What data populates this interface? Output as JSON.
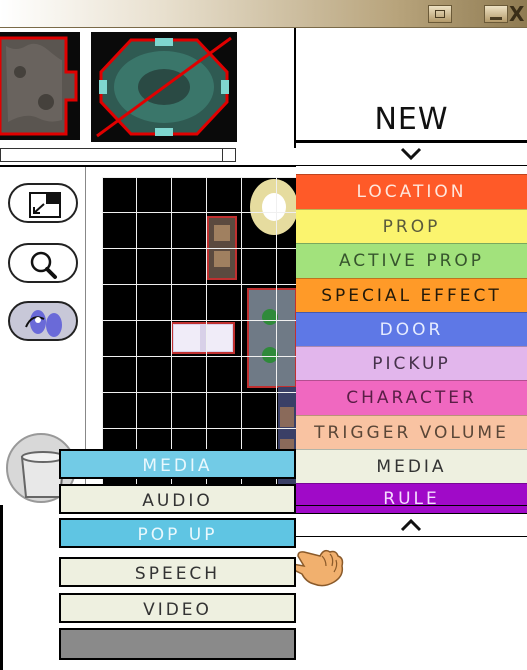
{
  "window": {
    "minimize_icon": "minimize-icon",
    "maximize_icon": "maximize-icon",
    "close_label": "X"
  },
  "new_panel": {
    "title": "NEW",
    "scroll_down_icon": "chevron-down-icon",
    "scroll_up_icon": "chevron-up-icon",
    "items": [
      {
        "label": "LOCATION",
        "bg": "#ff5a28",
        "color": "#ffe6dc"
      },
      {
        "label": "PROP",
        "bg": "#fbf46e",
        "color": "#5a5a3c"
      },
      {
        "label": "ACTIVE PROP",
        "bg": "#a2e27c",
        "color": "#37552d"
      },
      {
        "label": "SPECIAL EFFECT",
        "bg": "#ff9a28",
        "color": "#231a0a"
      },
      {
        "label": "DOOR",
        "bg": "#5e78e6",
        "color": "#e6ecff"
      },
      {
        "label": "PICKUP",
        "bg": "#e2b6ec",
        "color": "#46324b"
      },
      {
        "label": "CHARACTER",
        "bg": "#f068c0",
        "color": "#5a1e46"
      },
      {
        "label": "TRIGGER VOLUME",
        "bg": "#f9c3a2",
        "color": "#5a4637"
      },
      {
        "label": "MEDIA",
        "bg": "#eef0e0",
        "color": "#333333"
      },
      {
        "label": "RULE",
        "bg": "#a00ac8",
        "color": "#f5dcff"
      }
    ]
  },
  "media_menu": {
    "items": [
      "MEDIA",
      "AUDIO",
      "POP UP",
      "SPEECH",
      "VIDEO"
    ]
  },
  "tools": {
    "icons": [
      "expand-icon",
      "magnifier-icon",
      "footprints-icon",
      "trash-icon"
    ]
  },
  "cursor": "pointing-hand-icon"
}
